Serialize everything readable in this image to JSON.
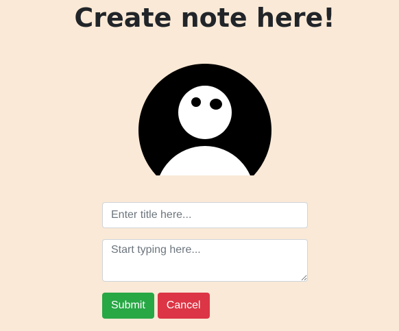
{
  "header": {
    "title": "Create note here!"
  },
  "avatar": {
    "icon": "user-avatar-icon",
    "background_color": "#000000",
    "figure_color": "#ffffff"
  },
  "form": {
    "title_placeholder": "Enter title here...",
    "title_value": "",
    "body_placeholder": "Start typing here...",
    "body_value": "",
    "submit_label": "Submit",
    "cancel_label": "Cancel"
  },
  "colors": {
    "page_background": "#fae9d6",
    "submit": "#28a745",
    "cancel": "#dc3545"
  }
}
